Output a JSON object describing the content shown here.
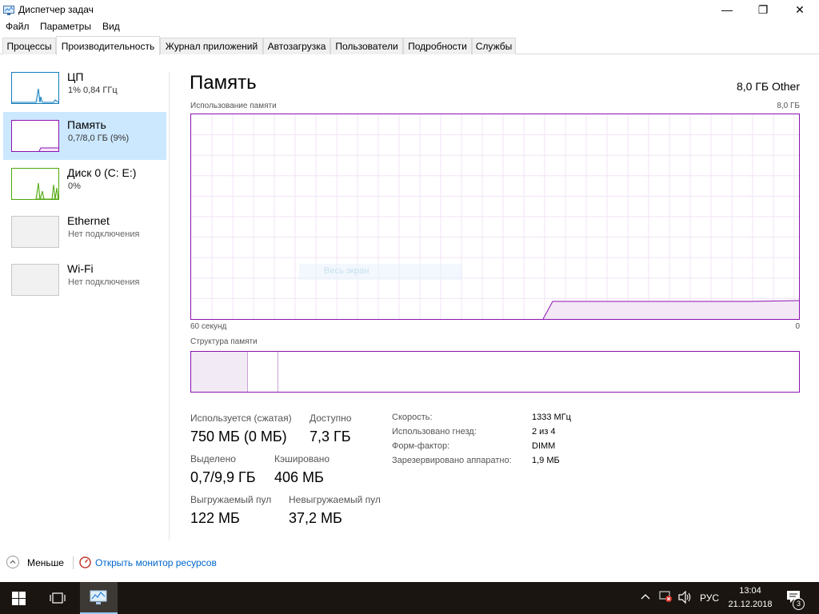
{
  "window": {
    "title": "Диспетчер задач",
    "minimize_glyph": "—",
    "maximize_glyph": "❐",
    "close_glyph": "✕"
  },
  "menu": [
    "Файл",
    "Параметры",
    "Вид"
  ],
  "tabs": [
    "Процессы",
    "Производительность",
    "Журнал приложений",
    "Автозагрузка",
    "Пользователи",
    "Подробности",
    "Службы"
  ],
  "active_tab": "Производительность",
  "sidebar": {
    "items": [
      {
        "title": "ЦП",
        "subtitle": "1% 0,84 ГГц",
        "color": "#117dbb"
      },
      {
        "title": "Память",
        "subtitle": "0,7/8,0 ГБ (9%)",
        "color": "#8b12ae"
      },
      {
        "title": "Диск 0 (C: E:)",
        "subtitle": "0%",
        "color": "#4da60c"
      },
      {
        "title": "Ethernet",
        "subtitle": "Нет подключения",
        "color": "#a0a0a0"
      },
      {
        "title": "Wi-Fi",
        "subtitle": "Нет подключения",
        "color": "#a0a0a0"
      }
    ]
  },
  "main": {
    "title": "Память",
    "total_label": "8,0 ГБ Other",
    "usage_label": "Использование памяти",
    "usage_max": "8,0 ГБ",
    "time_left": "60 секунд",
    "time_right": "0",
    "structure_label": "Структура памяти",
    "overlay_text": "Весь экран"
  },
  "stats": {
    "in_use_label": "Используется (сжатая)",
    "in_use_value": "750 МБ (0 МБ)",
    "available_label": "Доступно",
    "available_value": "7,3 ГБ",
    "committed_label": "Выделено",
    "committed_value": "0,7/9,9 ГБ",
    "cached_label": "Кэшировано",
    "cached_value": "406 МБ",
    "paged_label": "Выгружаемый пул",
    "paged_value": "122 МБ",
    "nonpaged_label": "Невыгружаемый пул",
    "nonpaged_value": "37,2 МБ"
  },
  "specs": [
    {
      "label": "Скорость:",
      "value": "1333 МГц"
    },
    {
      "label": "Использовано гнезд:",
      "value": "2 из 4"
    },
    {
      "label": "Форм-фактор:",
      "value": "DIMM"
    },
    {
      "label": "Зарезервировано аппаратно:",
      "value": "1,9 МБ"
    }
  ],
  "footer": {
    "less_label": "Меньше",
    "monitor_link": "Открыть монитор ресурсов"
  },
  "taskbar": {
    "language": "РУС",
    "time": "13:04",
    "date": "21.12.2018",
    "notification_count": "3"
  },
  "colors": {
    "memory_accent": "#8b12ae",
    "selection": "#cce8ff",
    "link": "#0066cc"
  }
}
